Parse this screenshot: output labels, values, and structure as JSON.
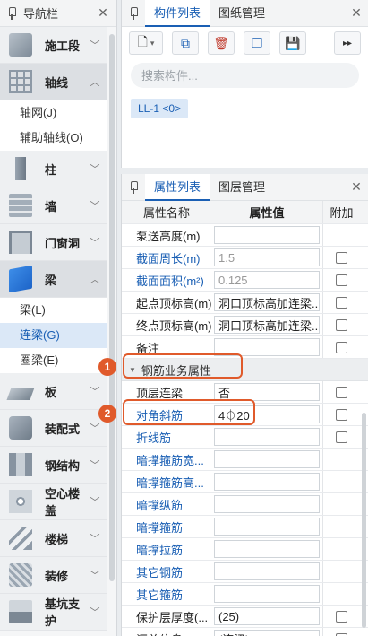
{
  "nav": {
    "title": "导航栏",
    "categories": [
      {
        "label": "施工段",
        "icon": "construction-section-icon"
      },
      {
        "label": "轴线",
        "icon": "axis-grid-icon",
        "expanded": true,
        "subitems": [
          "轴网(J)",
          "辅助轴线(O)"
        ]
      },
      {
        "label": "柱",
        "icon": "column-icon"
      },
      {
        "label": "墙",
        "icon": "wall-icon"
      },
      {
        "label": "门窗洞",
        "icon": "door-window-icon"
      },
      {
        "label": "梁",
        "icon": "beam-icon",
        "expanded": true,
        "subitems": [
          "梁(L)",
          "连梁(G)",
          "圈梁(E)"
        ],
        "selected_sub": "连梁(G)"
      },
      {
        "label": "板",
        "icon": "slab-icon"
      },
      {
        "label": "装配式",
        "icon": "prefab-icon"
      },
      {
        "label": "钢结构",
        "icon": "steel-structure-icon"
      },
      {
        "label": "空心楼盖",
        "icon": "hollow-floor-icon"
      },
      {
        "label": "楼梯",
        "icon": "stair-icon"
      },
      {
        "label": "装修",
        "icon": "decoration-icon"
      },
      {
        "label": "基坑支护",
        "icon": "pit-support-icon"
      }
    ]
  },
  "component_panel": {
    "tabs": [
      "构件列表",
      "图纸管理"
    ],
    "search_placeholder": "搜索构件...",
    "item": "LL-1 <0>"
  },
  "property_panel": {
    "tabs": [
      "属性列表",
      "图层管理"
    ],
    "headers": {
      "name": "属性名称",
      "value": "属性值",
      "add": "附加"
    },
    "rows_top": [
      {
        "name": "泵送高度(m)",
        "value": "",
        "blue": false,
        "check": false
      },
      {
        "name": "截面周长(m)",
        "value": "1.5",
        "blue": true,
        "gray": true,
        "check": true
      },
      {
        "name": "截面面积(m²)",
        "value": "0.125",
        "blue": true,
        "gray": true,
        "check": true
      },
      {
        "name": "起点顶标高(m)",
        "value": "洞口顶标高加连梁...",
        "blue": false,
        "check": true
      },
      {
        "name": "终点顶标高(m)",
        "value": "洞口顶标高加连梁...",
        "blue": false,
        "check": true
      },
      {
        "name": "备注",
        "value": "",
        "blue": false,
        "check": true
      }
    ],
    "group_label": "钢筋业务属性",
    "rows_bottom": [
      {
        "name": "顶层连梁",
        "value": "否",
        "blue": false,
        "check": true
      },
      {
        "name": "对角斜筋",
        "value": "4⏀20",
        "blue": true,
        "check": true
      },
      {
        "name": "折线筋",
        "value": "",
        "blue": true,
        "check": true
      },
      {
        "name": "暗撑箍筋宽...",
        "value": "",
        "blue": true,
        "check": false
      },
      {
        "name": "暗撑箍筋高...",
        "value": "",
        "blue": true,
        "check": false
      },
      {
        "name": "暗撑纵筋",
        "value": "",
        "blue": true,
        "check": false
      },
      {
        "name": "暗撑箍筋",
        "value": "",
        "blue": true,
        "check": false
      },
      {
        "name": "暗撑拉筋",
        "value": "",
        "blue": true,
        "check": false
      },
      {
        "name": "其它钢筋",
        "value": "",
        "blue": true,
        "check": false
      },
      {
        "name": "其它箍筋",
        "value": "",
        "blue": true,
        "check": false
      },
      {
        "name": "保护层厚度(...",
        "value": "(25)",
        "blue": false,
        "check": true
      },
      {
        "name": "汇总信息",
        "value": "(连梁)",
        "blue": false,
        "check": true
      }
    ]
  },
  "annotations": {
    "badge1": "1",
    "badge2": "2"
  }
}
